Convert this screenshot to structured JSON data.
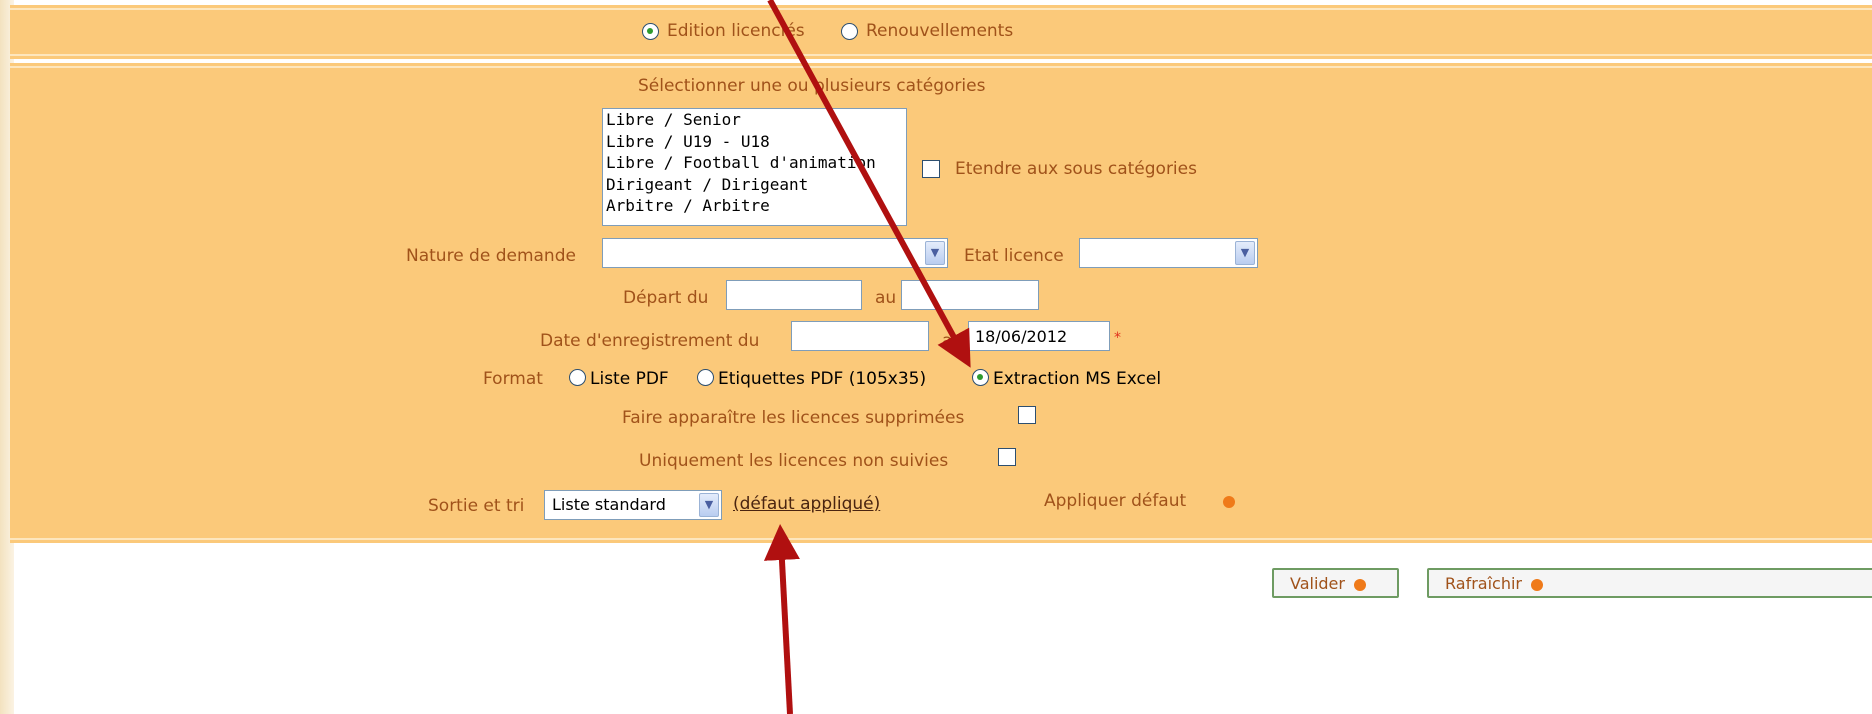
{
  "mode": {
    "options": [
      "Edition licenciés",
      "Renouvellements"
    ],
    "selected": 0
  },
  "categories": {
    "heading": "Sélectionner une ou plusieurs catégories",
    "items": [
      "Libre / Senior",
      "Libre / U19 - U18",
      "Libre / Football d'animation",
      "Dirigeant / Dirigeant",
      "Arbitre / Arbitre"
    ],
    "extend_label": "Etendre aux sous catégories",
    "extend_checked": false
  },
  "filters": {
    "nature_label": "Nature de demande",
    "nature_value": "",
    "etat_label": "Etat licence",
    "etat_value": "",
    "depart_label": "Départ du",
    "depart_from": "",
    "au_label": "au",
    "depart_to": "",
    "date_label": "Date d'enregistrement du",
    "date_from": "",
    "date_to": "18/06/2012",
    "required_mark": "*"
  },
  "format": {
    "label": "Format",
    "options": [
      "Liste PDF",
      "Etiquettes PDF (105x35)",
      "Extraction MS Excel"
    ],
    "selected": 2
  },
  "options": {
    "deleted_label": "Faire apparaître les licences supprimées",
    "deleted_checked": false,
    "unfollowed_label": "Uniquement les licences non suivies",
    "unfollowed_checked": false
  },
  "output": {
    "label": "Sortie et tri",
    "value": "Liste standard",
    "default_link": "(défaut appliqué)",
    "apply_default": "Appliquer défaut"
  },
  "buttons": {
    "validate": "Valider",
    "refresh": "Rafraîchir"
  },
  "colors": {
    "panel": "#fbc97a",
    "text": "#a0521a",
    "arrow": "#b01010",
    "dot": "#ef7a19"
  }
}
